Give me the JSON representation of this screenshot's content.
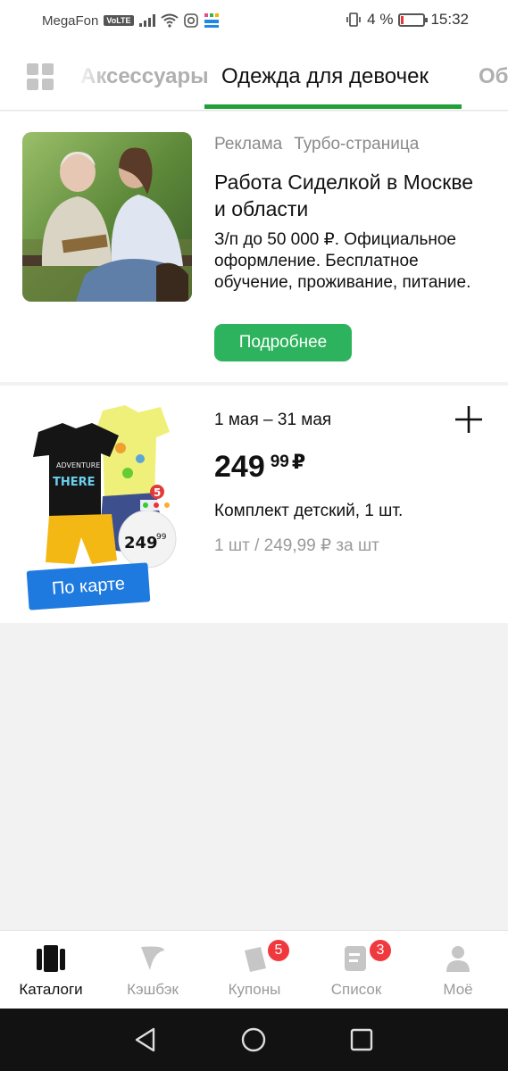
{
  "status_bar": {
    "carrier": "MegaFon",
    "volte": "VoLTE",
    "battery_percent": "4 %",
    "time": "15:32"
  },
  "tabs": {
    "prev": "Аксессуары",
    "active": "Одежда для девочек",
    "next": "Обувь"
  },
  "ad": {
    "label": "Реклама",
    "source": "Турбо-страница",
    "title": "Работа Сиделкой в Москве и области",
    "description": "З/п до 50 000 ₽. Официальное оформление. Бесплатное обучение, проживание, питание.",
    "button": "Подробнее"
  },
  "product": {
    "dates": "1 мая – 31 мая",
    "price_whole": "249",
    "price_fraction": "99",
    "currency": "₽",
    "name": "Комплект детский, 1 шт.",
    "unit_price": "1 шт / 249,99 ₽ за шт",
    "promo_badge": "По карте",
    "sticker_price": "249",
    "sticker_fraction": "99",
    "sticker_brand": "5"
  },
  "bottom_nav": {
    "items": [
      {
        "label": "Каталоги",
        "icon": "catalogs-icon",
        "active": true
      },
      {
        "label": "Кэшбэк",
        "icon": "cashback-icon",
        "active": false
      },
      {
        "label": "Купоны",
        "icon": "coupons-icon",
        "badge": "5",
        "active": false
      },
      {
        "label": "Список",
        "icon": "list-icon",
        "badge": "3",
        "active": false
      },
      {
        "label": "Моё",
        "icon": "profile-icon",
        "active": false
      }
    ]
  },
  "colors": {
    "accent_green": "#21a038",
    "button_green": "#2db35d",
    "badge_blue": "#1f7ae0",
    "badge_red": "#f0393e"
  }
}
